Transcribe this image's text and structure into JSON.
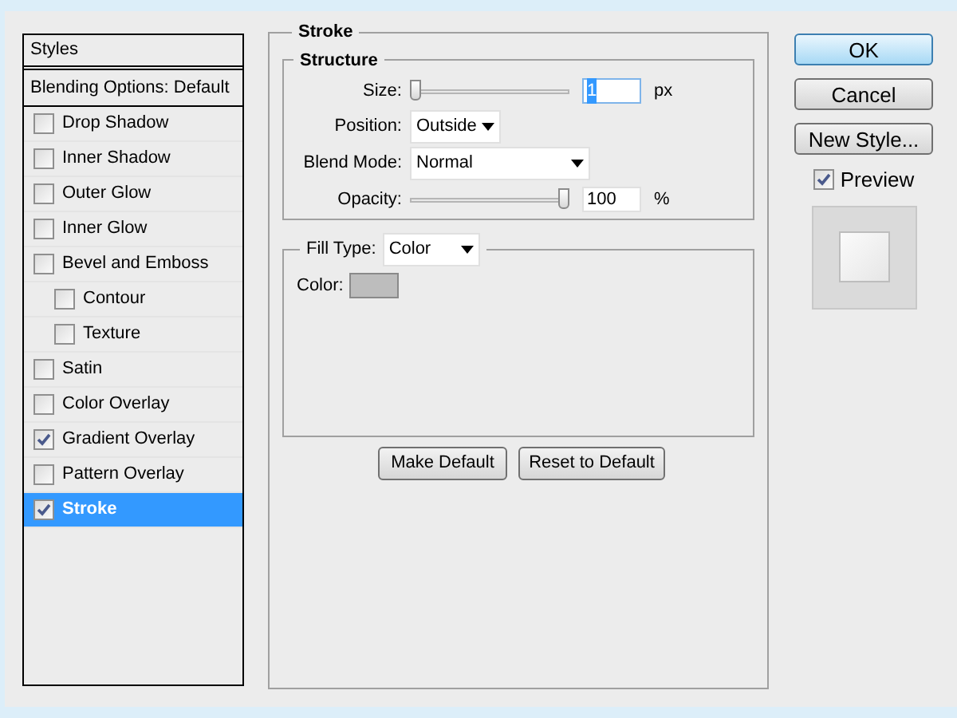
{
  "styles_panel": {
    "header": "Styles",
    "blending_options": "Blending Options: Default",
    "items": [
      {
        "label": "Drop Shadow",
        "checked": false,
        "selected": false
      },
      {
        "label": "Inner Shadow",
        "checked": false,
        "selected": false
      },
      {
        "label": "Outer Glow",
        "checked": false,
        "selected": false
      },
      {
        "label": "Inner Glow",
        "checked": false,
        "selected": false
      },
      {
        "label": "Bevel and Emboss",
        "checked": false,
        "selected": false,
        "children": [
          {
            "label": "Contour",
            "checked": false,
            "selected": false
          },
          {
            "label": "Texture",
            "checked": false,
            "selected": false
          }
        ]
      },
      {
        "label": "Satin",
        "checked": false,
        "selected": false
      },
      {
        "label": "Color Overlay",
        "checked": false,
        "selected": false
      },
      {
        "label": "Gradient Overlay",
        "checked": true,
        "selected": false
      },
      {
        "label": "Pattern Overlay",
        "checked": false,
        "selected": false
      },
      {
        "label": "Stroke",
        "checked": true,
        "selected": true
      }
    ]
  },
  "stroke": {
    "title": "Stroke",
    "structure": {
      "title": "Structure",
      "size": {
        "label": "Size:",
        "level": 0,
        "value": "1",
        "value_selected": true,
        "unit": "px"
      },
      "position": {
        "label": "Position:",
        "value": "Outside"
      },
      "blend_mode": {
        "label": "Blend Mode:",
        "value": "Normal"
      },
      "opacity": {
        "label": "Opacity:",
        "level": 1,
        "value": "100",
        "unit": "%"
      }
    },
    "fill": {
      "label": "Fill Type:",
      "value": "Color",
      "color_label": "Color:",
      "color": "#bdbdbd"
    },
    "buttons": [
      "Make Default",
      "Reset to Default"
    ]
  },
  "actions": [
    {
      "label": "OK",
      "default": true
    },
    {
      "label": "Cancel",
      "default": false
    },
    {
      "label": "New Style...",
      "default": false
    }
  ],
  "preview": {
    "label": "Preview",
    "checked": true
  }
}
